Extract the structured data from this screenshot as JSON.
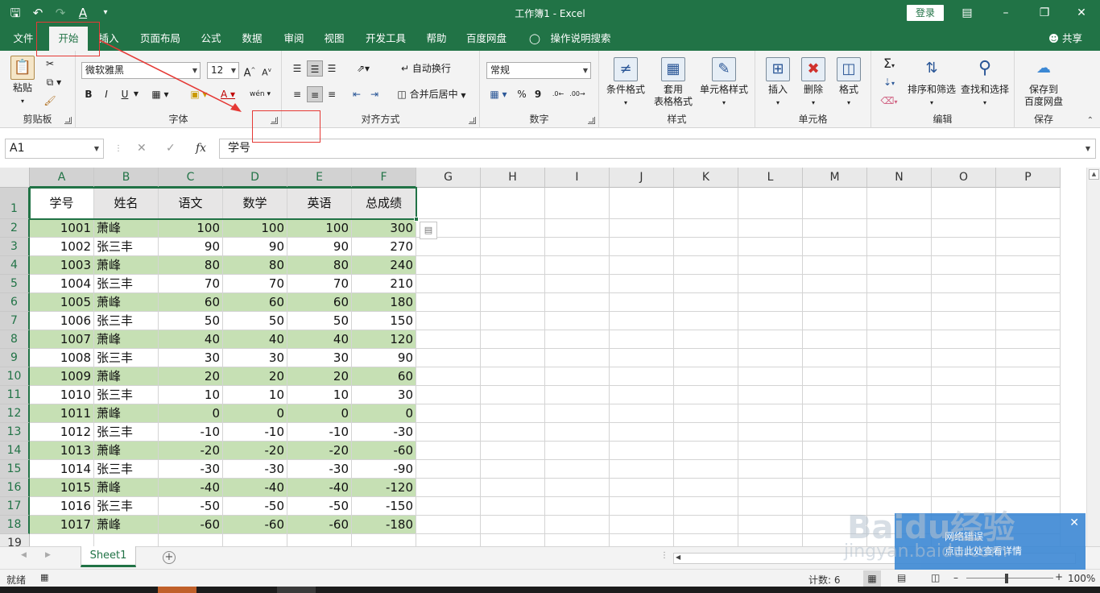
{
  "app": {
    "title": "工作簿1  -  Excel",
    "login": "登录",
    "share": "共享"
  },
  "tabs": [
    "文件",
    "开始",
    "插入",
    "页面布局",
    "公式",
    "数据",
    "审阅",
    "视图",
    "开发工具",
    "帮助",
    "百度网盘",
    "操作说明搜索"
  ],
  "ribbon": {
    "clipboard": {
      "paste": "粘贴",
      "label": "剪贴板"
    },
    "font": {
      "name": "微软雅黑",
      "size": "12",
      "bold": "B",
      "italic": "I",
      "underline": "U",
      "label": "字体",
      "grow": "A˄",
      "shrink": "A˅"
    },
    "align": {
      "wrap": "自动换行",
      "merge": "合并后居中",
      "label": "对齐方式"
    },
    "number": {
      "format": "常规",
      "percent": "%",
      "comma": "9",
      "label": "数字"
    },
    "styles": {
      "cond": "条件格式",
      "table1": "套用",
      "table2": "表格格式",
      "cell": "单元格样式",
      "label": "样式"
    },
    "cells": {
      "insert": "插入",
      "delete": "删除",
      "format": "格式",
      "label": "单元格"
    },
    "edit": {
      "sort": "排序和筛选",
      "find": "查找和选择",
      "label": "编辑"
    },
    "save": {
      "line1": "保存到",
      "line2": "百度网盘",
      "label": "保存"
    }
  },
  "formula_bar": {
    "name_box": "A1",
    "fx": "fx",
    "content": "学号"
  },
  "columns": [
    "A",
    "B",
    "C",
    "D",
    "E",
    "F",
    "G",
    "H",
    "I",
    "J",
    "K",
    "L",
    "M",
    "N",
    "O",
    "P"
  ],
  "table": {
    "headers": [
      "学号",
      "姓名",
      "语文",
      "数学",
      "英语",
      "总成绩"
    ],
    "rows": [
      [
        "1001",
        "萧峰",
        "100",
        "100",
        "100",
        "300"
      ],
      [
        "1002",
        "张三丰",
        "90",
        "90",
        "90",
        "270"
      ],
      [
        "1003",
        "萧峰",
        "80",
        "80",
        "80",
        "240"
      ],
      [
        "1004",
        "张三丰",
        "70",
        "70",
        "70",
        "210"
      ],
      [
        "1005",
        "萧峰",
        "60",
        "60",
        "60",
        "180"
      ],
      [
        "1006",
        "张三丰",
        "50",
        "50",
        "50",
        "150"
      ],
      [
        "1007",
        "萧峰",
        "40",
        "40",
        "40",
        "120"
      ],
      [
        "1008",
        "张三丰",
        "30",
        "30",
        "30",
        "90"
      ],
      [
        "1009",
        "萧峰",
        "20",
        "20",
        "20",
        "60"
      ],
      [
        "1010",
        "张三丰",
        "10",
        "10",
        "10",
        "30"
      ],
      [
        "1011",
        "萧峰",
        "0",
        "0",
        "0",
        "0"
      ],
      [
        "1012",
        "张三丰",
        "-10",
        "-10",
        "-10",
        "-30"
      ],
      [
        "1013",
        "萧峰",
        "-20",
        "-20",
        "-20",
        "-60"
      ],
      [
        "1014",
        "张三丰",
        "-30",
        "-30",
        "-30",
        "-90"
      ],
      [
        "1015",
        "萧峰",
        "-40",
        "-40",
        "-40",
        "-120"
      ],
      [
        "1016",
        "张三丰",
        "-50",
        "-50",
        "-50",
        "-150"
      ],
      [
        "1017",
        "萧峰",
        "-60",
        "-60",
        "-60",
        "-180"
      ]
    ]
  },
  "row_numbers": [
    "1",
    "2",
    "3",
    "4",
    "5",
    "6",
    "7",
    "8",
    "9",
    "10",
    "11",
    "12",
    "13",
    "14",
    "15",
    "16",
    "17",
    "18",
    "19"
  ],
  "sheet": {
    "tab": "Sheet1",
    "add": "+"
  },
  "status": {
    "mode": "就绪",
    "count": "计数: 6",
    "zoom": "100%"
  },
  "popup": {
    "line1": "网络错误",
    "line2": "点击此处查看详情",
    "close": "✕"
  },
  "watermark": {
    "brand": "Baidu经验",
    "url": "jingyan.baidu.com"
  },
  "colors": {
    "excel_green": "#217346",
    "row_green": "#c6e0b4",
    "header_gray": "#e7e6e6",
    "annotation_red": "#e53935"
  }
}
